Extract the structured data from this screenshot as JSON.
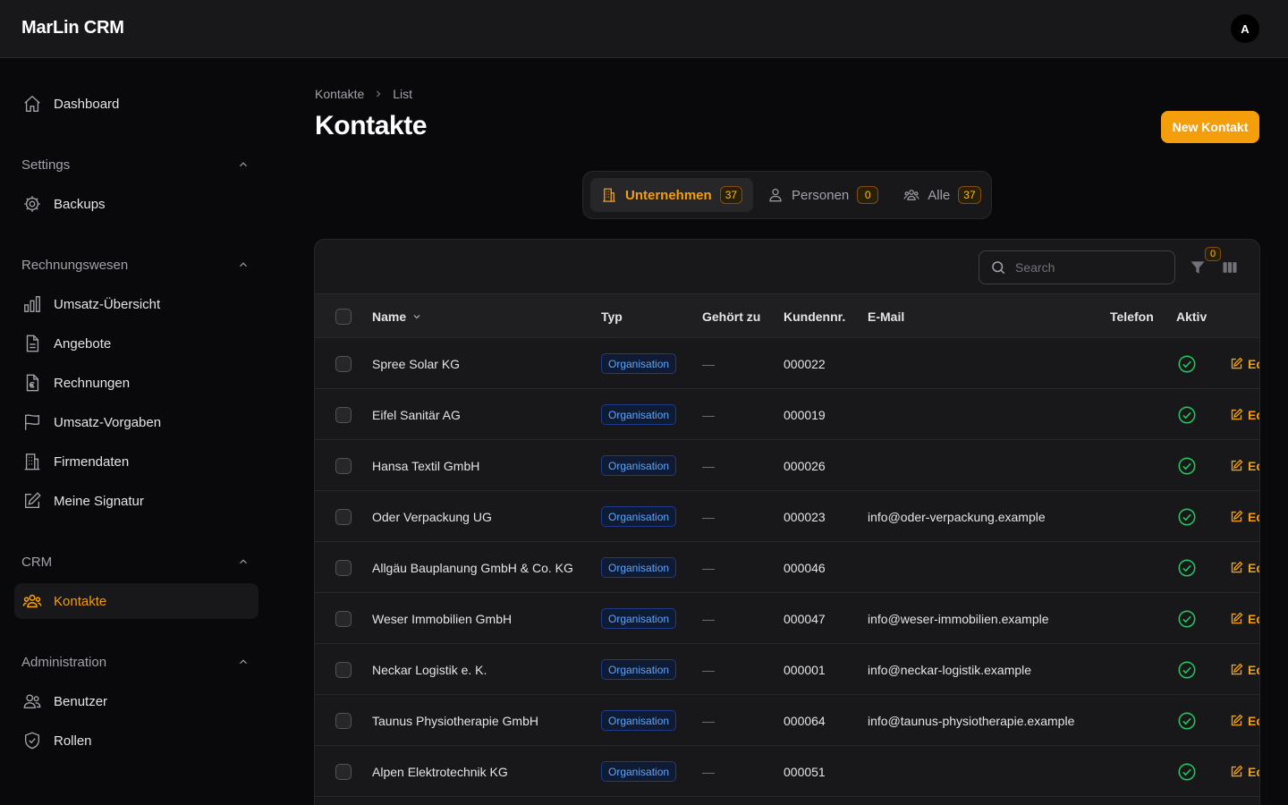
{
  "app": {
    "title": "MarLin CRM",
    "user_initial": "A"
  },
  "sidebar": {
    "top_items": [
      {
        "label": "Dashboard",
        "icon": "home-icon"
      }
    ],
    "groups": [
      {
        "label": "Settings",
        "items": [
          {
            "label": "Backups",
            "icon": "gear-icon"
          }
        ]
      },
      {
        "label": "Rechnungswesen",
        "items": [
          {
            "label": "Umsatz-Übersicht",
            "icon": "bar-chart-icon"
          },
          {
            "label": "Angebote",
            "icon": "document-icon"
          },
          {
            "label": "Rechnungen",
            "icon": "invoice-icon"
          },
          {
            "label": "Umsatz-Vorgaben",
            "icon": "flag-icon"
          },
          {
            "label": "Firmendaten",
            "icon": "building-icon"
          },
          {
            "label": "Meine Signatur",
            "icon": "pencil-square-icon"
          }
        ]
      },
      {
        "label": "CRM",
        "items": [
          {
            "label": "Kontakte",
            "icon": "users-icon",
            "active": true
          }
        ]
      },
      {
        "label": "Administration",
        "items": [
          {
            "label": "Benutzer",
            "icon": "users-icon"
          },
          {
            "label": "Rollen",
            "icon": "shield-icon"
          }
        ]
      }
    ]
  },
  "breadcrumb": {
    "first": "Kontakte",
    "second": "List"
  },
  "page": {
    "title": "Kontakte",
    "new_button": "New Kontakt"
  },
  "tabs": [
    {
      "label": "Unternehmen",
      "count": "37",
      "icon": "building-icon",
      "active": true
    },
    {
      "label": "Personen",
      "count": "0",
      "icon": "user-icon"
    },
    {
      "label": "Alle",
      "count": "37",
      "icon": "users-icon"
    }
  ],
  "toolbar": {
    "search_placeholder": "Search",
    "filter_count": "0"
  },
  "table": {
    "columns": {
      "name": "Name",
      "typ": "Typ",
      "gehoert_zu": "Gehört zu",
      "kundennr": "Kundennr.",
      "email": "E-Mail",
      "telefon": "Telefon",
      "aktiv": "Aktiv"
    },
    "edit_label": "Edit",
    "rows": [
      {
        "name": "Spree Solar KG",
        "typ": "Organisation",
        "gehoert_zu": "—",
        "kundennr": "000022",
        "email": "",
        "telefon": "",
        "aktiv": true
      },
      {
        "name": "Eifel Sanitär AG",
        "typ": "Organisation",
        "gehoert_zu": "—",
        "kundennr": "000019",
        "email": "",
        "telefon": "",
        "aktiv": true
      },
      {
        "name": "Hansa Textil GmbH",
        "typ": "Organisation",
        "gehoert_zu": "—",
        "kundennr": "000026",
        "email": "",
        "telefon": "",
        "aktiv": true
      },
      {
        "name": "Oder Verpackung UG",
        "typ": "Organisation",
        "gehoert_zu": "—",
        "kundennr": "000023",
        "email": "info@oder-verpackung.example",
        "telefon": "",
        "aktiv": true
      },
      {
        "name": "Allgäu Bauplanung GmbH & Co. KG",
        "typ": "Organisation",
        "gehoert_zu": "—",
        "kundennr": "000046",
        "email": "",
        "telefon": "",
        "aktiv": true
      },
      {
        "name": "Weser Immobilien GmbH",
        "typ": "Organisation",
        "gehoert_zu": "—",
        "kundennr": "000047",
        "email": "info@weser-immobilien.example",
        "telefon": "",
        "aktiv": true
      },
      {
        "name": "Neckar Logistik e. K.",
        "typ": "Organisation",
        "gehoert_zu": "—",
        "kundennr": "000001",
        "email": "info@neckar-logistik.example",
        "telefon": "",
        "aktiv": true
      },
      {
        "name": "Taunus Physiotherapie GmbH",
        "typ": "Organisation",
        "gehoert_zu": "—",
        "kundennr": "000064",
        "email": "info@taunus-physiotherapie.example",
        "telefon": "",
        "aktiv": true
      },
      {
        "name": "Alpen Elektrotechnik KG",
        "typ": "Organisation",
        "gehoert_zu": "—",
        "kundennr": "000051",
        "email": "",
        "telefon": "",
        "aktiv": true
      }
    ]
  },
  "colors": {
    "accent": "#f59e0b",
    "success": "#22c55e",
    "badge_blue": "#60a5fa"
  }
}
